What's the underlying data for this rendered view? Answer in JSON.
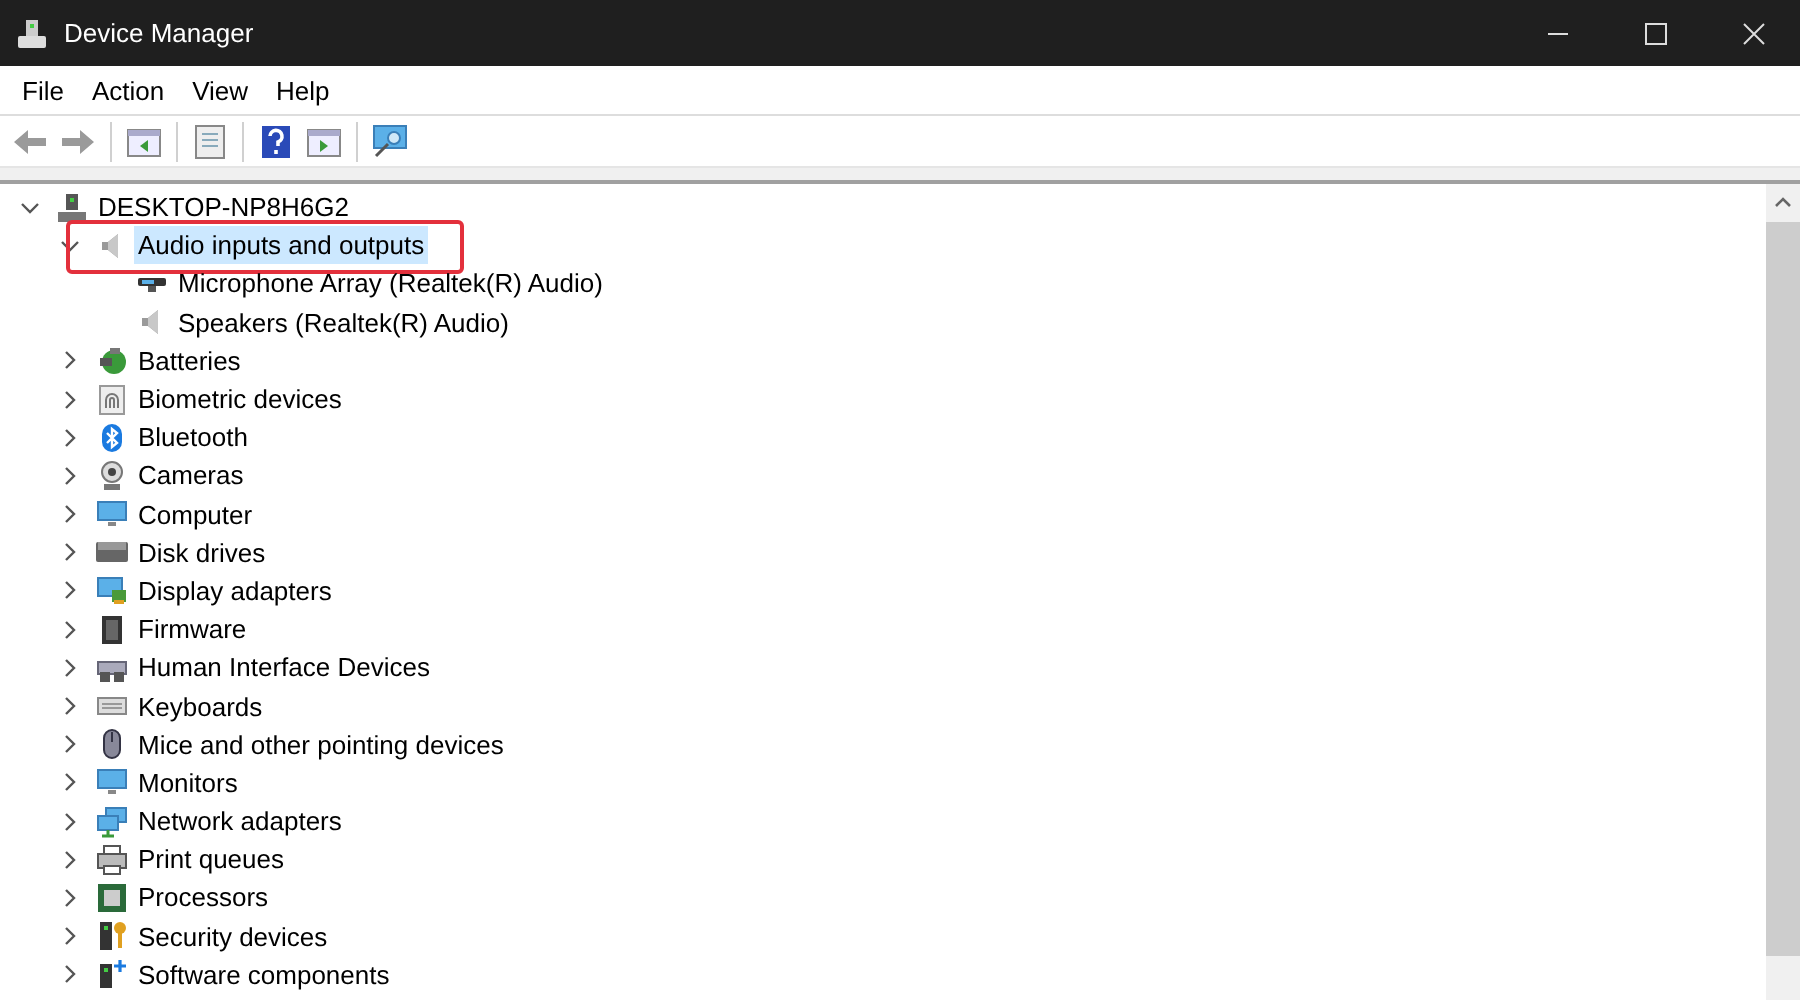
{
  "window": {
    "title": "Device Manager"
  },
  "menu": [
    {
      "label": "File"
    },
    {
      "label": "Action"
    },
    {
      "label": "View"
    },
    {
      "label": "Help"
    }
  ],
  "tree": {
    "label": "DESKTOP-NP8H6G2",
    "expanded": true,
    "children": [
      {
        "label": "Audio inputs and outputs",
        "expanded": true,
        "selected": true,
        "callout": true,
        "children": [
          {
            "label": "Microphone Array (Realtek(R) Audio)",
            "selected": false
          },
          {
            "label": "Speakers (Realtek(R) Audio)",
            "selected": false
          }
        ]
      },
      {
        "label": "Batteries",
        "expanded": false,
        "selected": false,
        "callout": false
      },
      {
        "label": "Biometric devices",
        "expanded": false,
        "selected": false,
        "callout": false
      },
      {
        "label": "Bluetooth",
        "expanded": false,
        "selected": false,
        "callout": false
      },
      {
        "label": "Cameras",
        "expanded": false,
        "selected": false,
        "callout": false
      },
      {
        "label": "Computer",
        "expanded": false,
        "selected": false,
        "callout": false
      },
      {
        "label": "Disk drives",
        "expanded": false,
        "selected": false,
        "callout": false
      },
      {
        "label": "Display adapters",
        "expanded": false,
        "selected": false,
        "callout": false
      },
      {
        "label": "Firmware",
        "expanded": false,
        "selected": false,
        "callout": false
      },
      {
        "label": "Human Interface Devices",
        "expanded": false,
        "selected": false,
        "callout": false
      },
      {
        "label": "Keyboards",
        "expanded": false,
        "selected": false,
        "callout": false
      },
      {
        "label": "Mice and other pointing devices",
        "expanded": false,
        "selected": false,
        "callout": false
      },
      {
        "label": "Monitors",
        "expanded": false,
        "selected": false,
        "callout": false
      },
      {
        "label": "Network adapters",
        "expanded": false,
        "selected": false,
        "callout": false
      },
      {
        "label": "Print queues",
        "expanded": false,
        "selected": false,
        "callout": false
      },
      {
        "label": "Processors",
        "expanded": false,
        "selected": false,
        "callout": false
      },
      {
        "label": "Security devices",
        "expanded": false,
        "selected": false,
        "callout": false
      },
      {
        "label": "Software components",
        "expanded": false,
        "selected": false,
        "callout": false
      }
    ]
  }
}
